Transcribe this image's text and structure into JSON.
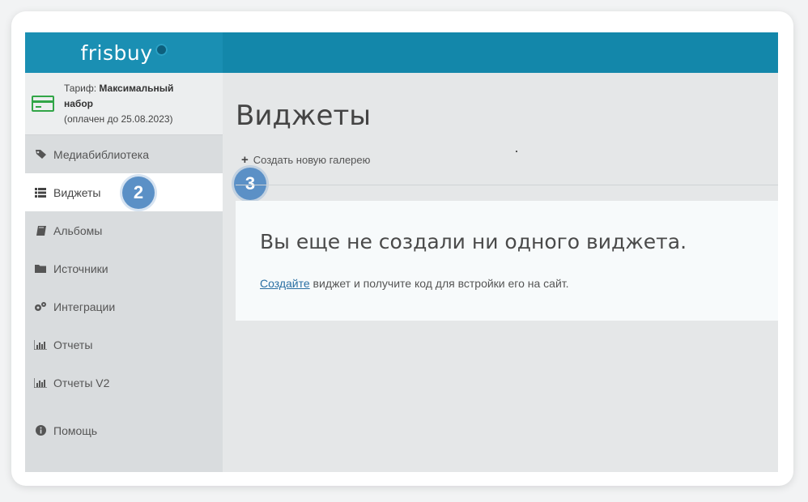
{
  "brand": {
    "logo_text": "frisbuy"
  },
  "tariff": {
    "prefix": "Тариф: ",
    "plan_line1": "Максимальный",
    "plan_line2": "набор",
    "paid_until": "(оплачен до 25.08.2023)"
  },
  "sidebar": {
    "items": [
      {
        "label": "Медиабиблиотека",
        "icon": "tags-icon"
      },
      {
        "label": "Виджеты",
        "icon": "list-icon",
        "active": true
      },
      {
        "label": "Альбомы",
        "icon": "book-icon"
      },
      {
        "label": "Источники",
        "icon": "folder-icon"
      },
      {
        "label": "Интеграции",
        "icon": "gears-icon"
      },
      {
        "label": "Отчеты",
        "icon": "bar-chart-icon"
      },
      {
        "label": "Отчеты V2",
        "icon": "bar-chart-icon"
      },
      {
        "label": "Помощь",
        "icon": "info-circle-icon"
      }
    ]
  },
  "main": {
    "title": "Виджеты",
    "create_label": "Создать новую галерею",
    "empty_title": "Вы еще не создали ни одного виджета.",
    "empty_link": "Создайте",
    "empty_text": " виджет и получите код для встройки его на сайт."
  },
  "annotations": {
    "badge_2": "2",
    "badge_3": "3"
  },
  "colors": {
    "topbar": "#1387aa",
    "badge": "#5b90c6",
    "card_icon": "#31a547",
    "link": "#2a6fa3"
  }
}
